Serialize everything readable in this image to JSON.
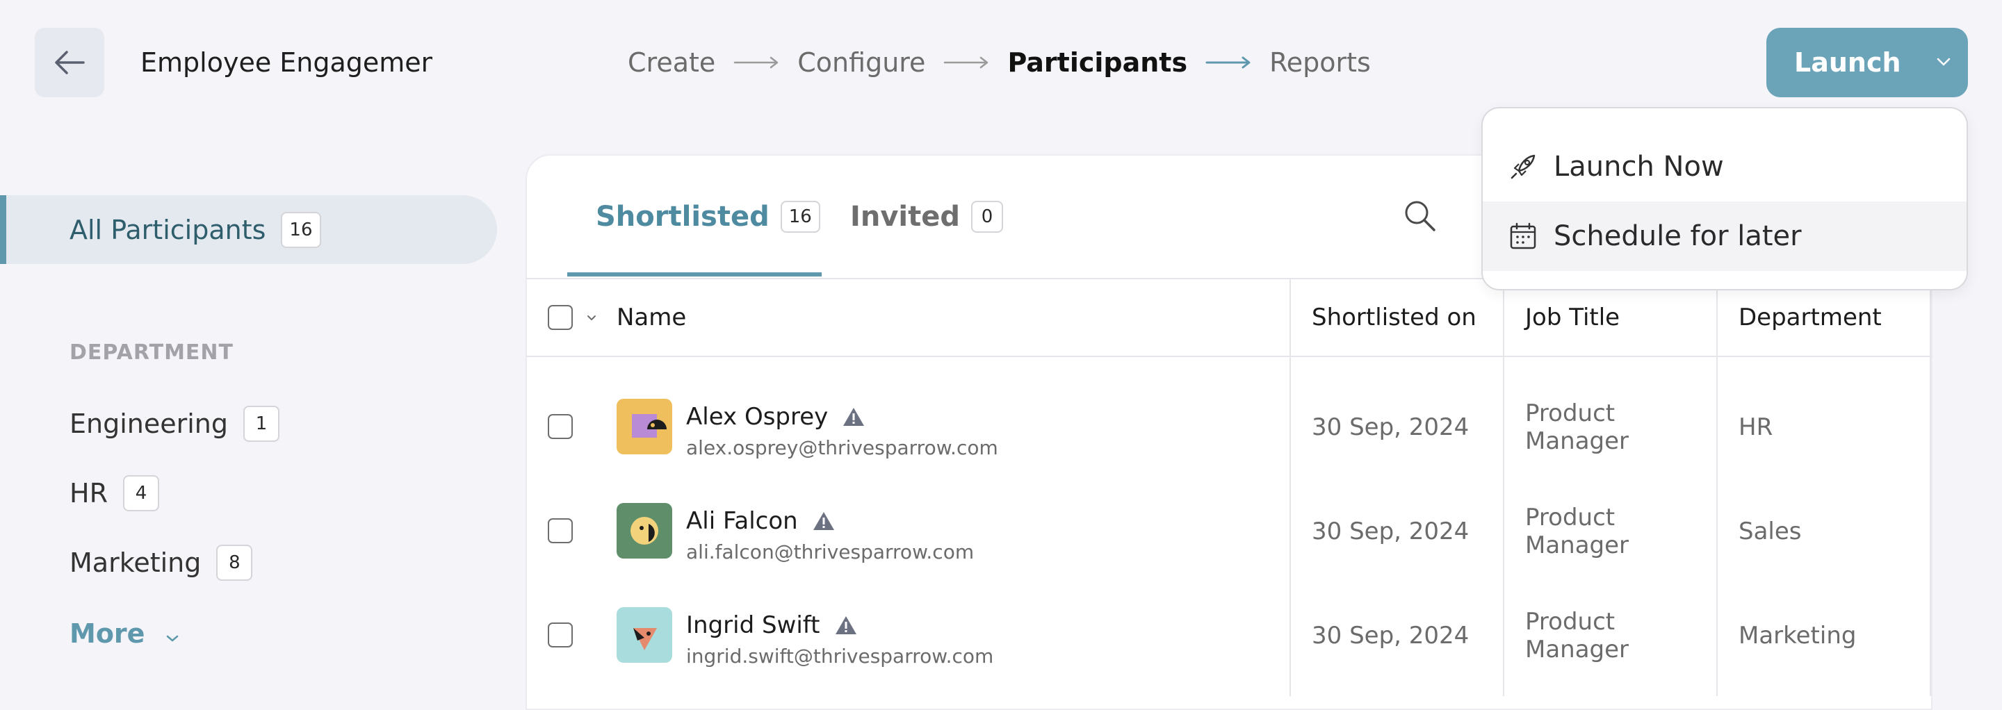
{
  "header": {
    "survey_title": "Employee Engagement",
    "steps": [
      "Create",
      "Configure",
      "Participants",
      "Reports"
    ],
    "active_step": "Participants",
    "launch_label": "Launch"
  },
  "launch_menu": {
    "items": [
      {
        "label": "Launch Now",
        "icon": "rocket-icon"
      },
      {
        "label": "Schedule for later",
        "icon": "calendar-icon"
      }
    ]
  },
  "sidebar": {
    "all_participants": {
      "label": "All Participants",
      "count": "16"
    },
    "department_heading": "DEPARTMENT",
    "departments": [
      {
        "label": "Engineering",
        "count": "1"
      },
      {
        "label": "HR",
        "count": "4"
      },
      {
        "label": "Marketing",
        "count": "8"
      }
    ],
    "more_label": "More"
  },
  "tabs": [
    {
      "label": "Shortlisted",
      "count": "16"
    },
    {
      "label": "Invited",
      "count": "0"
    }
  ],
  "table": {
    "columns": [
      "Name",
      "Shortlisted on",
      "Job Title",
      "Department"
    ],
    "rows": [
      {
        "name": "Alex Osprey",
        "email": "alex.osprey@thrivesparrow.com",
        "shortlisted_on": "30 Sep, 2024",
        "job_title_1": "Product",
        "job_title_2": "Manager",
        "department": "HR"
      },
      {
        "name": "Ali Falcon",
        "email": "ali.falcon@thrivesparrow.com",
        "shortlisted_on": "30 Sep, 2024",
        "job_title_1": "Product",
        "job_title_2": "Manager",
        "department": "Sales"
      },
      {
        "name": "Ingrid Swift",
        "email": "ingrid.swift@thrivesparrow.com",
        "shortlisted_on": "30 Sep, 2024",
        "job_title_1": "Product",
        "job_title_2": "Manager",
        "department": "Marketing"
      }
    ]
  },
  "colors": {
    "accent": "#5f98ad",
    "launch_button": "#6ba4b8",
    "background": "#f4f4f9"
  }
}
